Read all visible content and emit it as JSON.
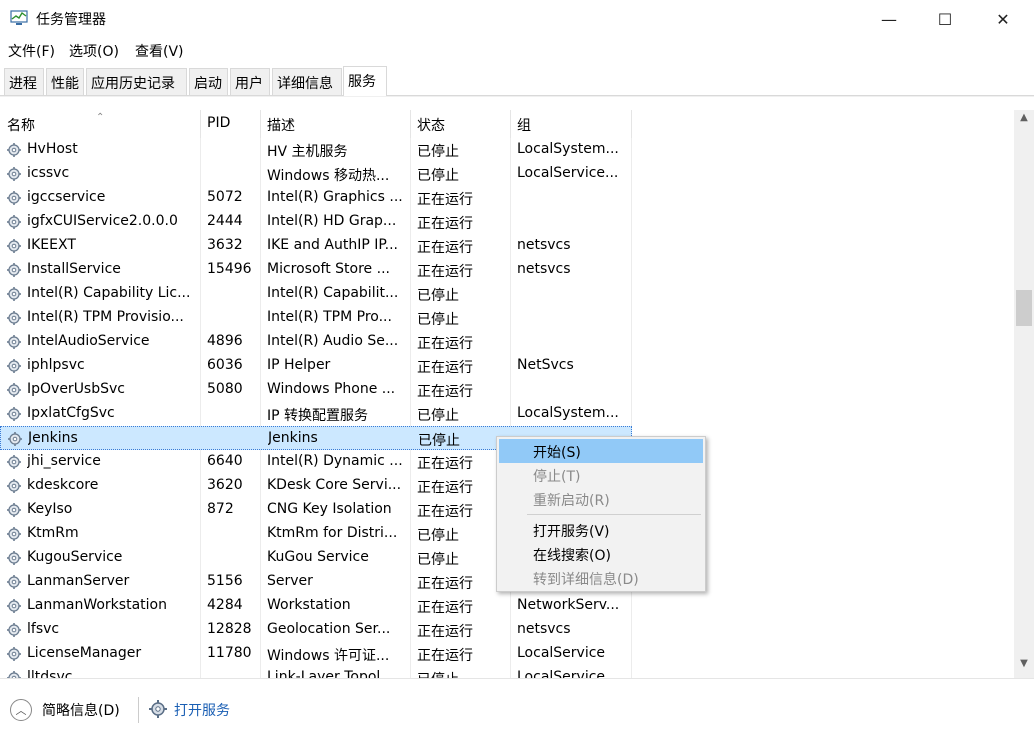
{
  "window": {
    "title": "任务管理器",
    "minimize_glyph": "—",
    "maximize_glyph": "☐",
    "close_glyph": "✕"
  },
  "menu": [
    {
      "label": "文件(F)"
    },
    {
      "label": "选项(O)"
    },
    {
      "label": "查看(V)"
    }
  ],
  "tabs": [
    {
      "label": "进程"
    },
    {
      "label": "性能"
    },
    {
      "label": "应用历史记录"
    },
    {
      "label": "启动"
    },
    {
      "label": "用户"
    },
    {
      "label": "详细信息"
    },
    {
      "label": "服务",
      "active": true
    }
  ],
  "columns": {
    "name": "名称",
    "pid": "PID",
    "desc": "描述",
    "status": "状态",
    "group": "组"
  },
  "rows": [
    {
      "name": "HvHost",
      "pid": "",
      "desc": "HV 主机服务",
      "status": "已停止",
      "group": "LocalSystem..."
    },
    {
      "name": "icssvc",
      "pid": "",
      "desc": "Windows 移动热...",
      "status": "已停止",
      "group": "LocalService..."
    },
    {
      "name": "igccservice",
      "pid": "5072",
      "desc": "Intel(R) Graphics ...",
      "status": "正在运行",
      "group": ""
    },
    {
      "name": "igfxCUIService2.0.0.0",
      "pid": "2444",
      "desc": "Intel(R) HD Grap...",
      "status": "正在运行",
      "group": ""
    },
    {
      "name": "IKEEXT",
      "pid": "3632",
      "desc": "IKE and AuthIP IP...",
      "status": "正在运行",
      "group": "netsvcs"
    },
    {
      "name": "InstallService",
      "pid": "15496",
      "desc": "Microsoft Store ...",
      "status": "正在运行",
      "group": "netsvcs"
    },
    {
      "name": "Intel(R) Capability Lic...",
      "pid": "",
      "desc": "Intel(R) Capabilit...",
      "status": "已停止",
      "group": ""
    },
    {
      "name": "Intel(R) TPM Provisio...",
      "pid": "",
      "desc": "Intel(R) TPM Pro...",
      "status": "已停止",
      "group": ""
    },
    {
      "name": "IntelAudioService",
      "pid": "4896",
      "desc": "Intel(R) Audio Se...",
      "status": "正在运行",
      "group": ""
    },
    {
      "name": "iphlpsvc",
      "pid": "6036",
      "desc": "IP Helper",
      "status": "正在运行",
      "group": "NetSvcs"
    },
    {
      "name": "IpOverUsbSvc",
      "pid": "5080",
      "desc": "Windows Phone ...",
      "status": "正在运行",
      "group": ""
    },
    {
      "name": "IpxlatCfgSvc",
      "pid": "",
      "desc": "IP 转换配置服务",
      "status": "已停止",
      "group": "LocalSystem..."
    },
    {
      "name": "Jenkins",
      "pid": "",
      "desc": "Jenkins",
      "status": "已停止",
      "group": "",
      "selected": true
    },
    {
      "name": "jhi_service",
      "pid": "6640",
      "desc": "Intel(R) Dynamic ...",
      "status": "正在运行",
      "group": ""
    },
    {
      "name": "kdeskcore",
      "pid": "3620",
      "desc": "KDesk Core Servi...",
      "status": "正在运行",
      "group": ""
    },
    {
      "name": "KeyIso",
      "pid": "872",
      "desc": "CNG Key Isolation",
      "status": "正在运行",
      "group": ""
    },
    {
      "name": "KtmRm",
      "pid": "",
      "desc": "KtmRm for Distri...",
      "status": "已停止",
      "group": ""
    },
    {
      "name": "KugouService",
      "pid": "",
      "desc": "KuGou Service",
      "status": "已停止",
      "group": ""
    },
    {
      "name": "LanmanServer",
      "pid": "5156",
      "desc": "Server",
      "status": "正在运行",
      "group": ""
    },
    {
      "name": "LanmanWorkstation",
      "pid": "4284",
      "desc": "Workstation",
      "status": "正在运行",
      "group": "NetworkServ..."
    },
    {
      "name": "lfsvc",
      "pid": "12828",
      "desc": "Geolocation Ser...",
      "status": "正在运行",
      "group": "netsvcs"
    },
    {
      "name": "LicenseManager",
      "pid": "11780",
      "desc": "Windows 许可证...",
      "status": "正在运行",
      "group": "LocalService"
    },
    {
      "name": "lltdsvc",
      "pid": "",
      "desc": "Link-Layer Topol...",
      "status": "已停止",
      "group": "LocalService"
    }
  ],
  "context_menu": [
    {
      "label": "开始(S)",
      "state": "hover"
    },
    {
      "label": "停止(T)",
      "state": "disabled"
    },
    {
      "label": "重新启动(R)",
      "state": "disabled"
    },
    {
      "label": "打开服务(V)",
      "state": "normal"
    },
    {
      "label": "在线搜索(O)",
      "state": "normal"
    },
    {
      "label": "转到详细信息(D)",
      "state": "disabled"
    }
  ],
  "footer": {
    "summary_label": "简略信息(D)",
    "open_services_label": "打开服务"
  },
  "colors": {
    "selection": "#cce8ff",
    "menu_hover": "#91c9f7",
    "link": "#1a5fb4"
  }
}
